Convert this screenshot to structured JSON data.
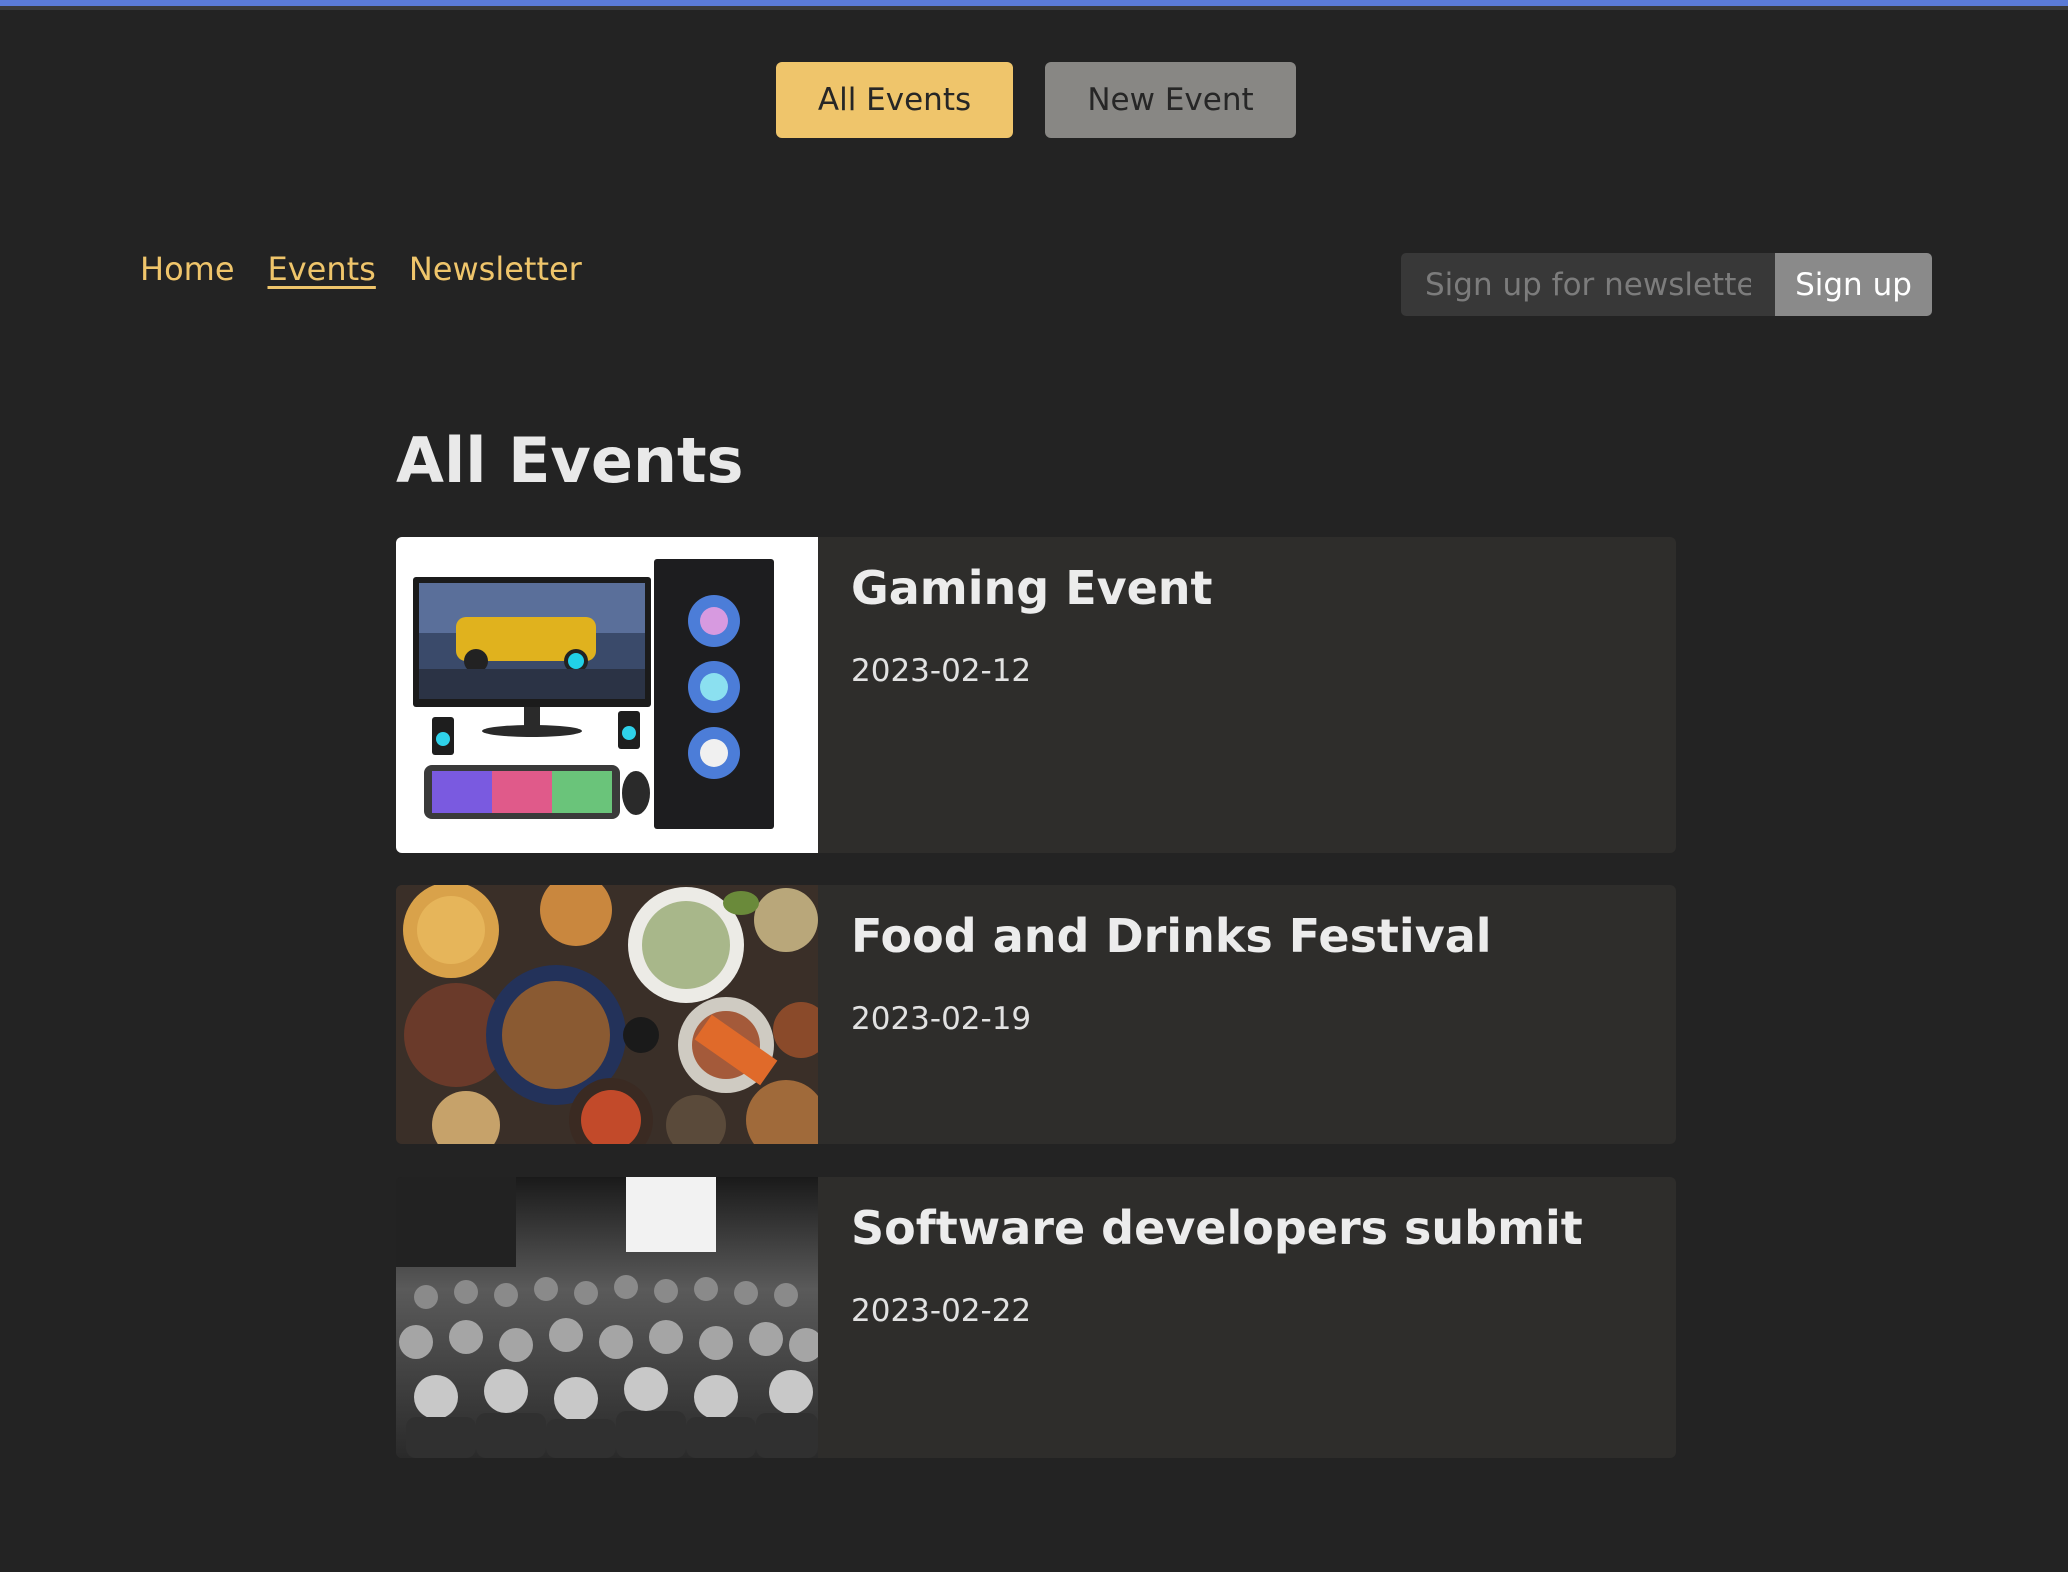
{
  "toolbar": {
    "all_events_label": "All Events",
    "new_event_label": "New Event"
  },
  "nav": {
    "items": [
      {
        "label": "Home"
      },
      {
        "label": "Events",
        "active": true
      },
      {
        "label": "Newsletter"
      }
    ]
  },
  "newsletter": {
    "placeholder": "Sign up for newsletter..",
    "button_label": "Sign up"
  },
  "page": {
    "title": "All Events"
  },
  "events": [
    {
      "title": "Gaming Event",
      "date": "2023-02-12",
      "image": "gaming-pc-image"
    },
    {
      "title": "Food and Drinks Festival",
      "date": "2023-02-19",
      "image": "food-spread-image"
    },
    {
      "title": "Software developers submit",
      "date": "2023-02-22",
      "image": "conference-audience-image"
    }
  ],
  "colors": {
    "background": "#232323",
    "accent": "#efc56b",
    "card": "#2e2d2b"
  }
}
